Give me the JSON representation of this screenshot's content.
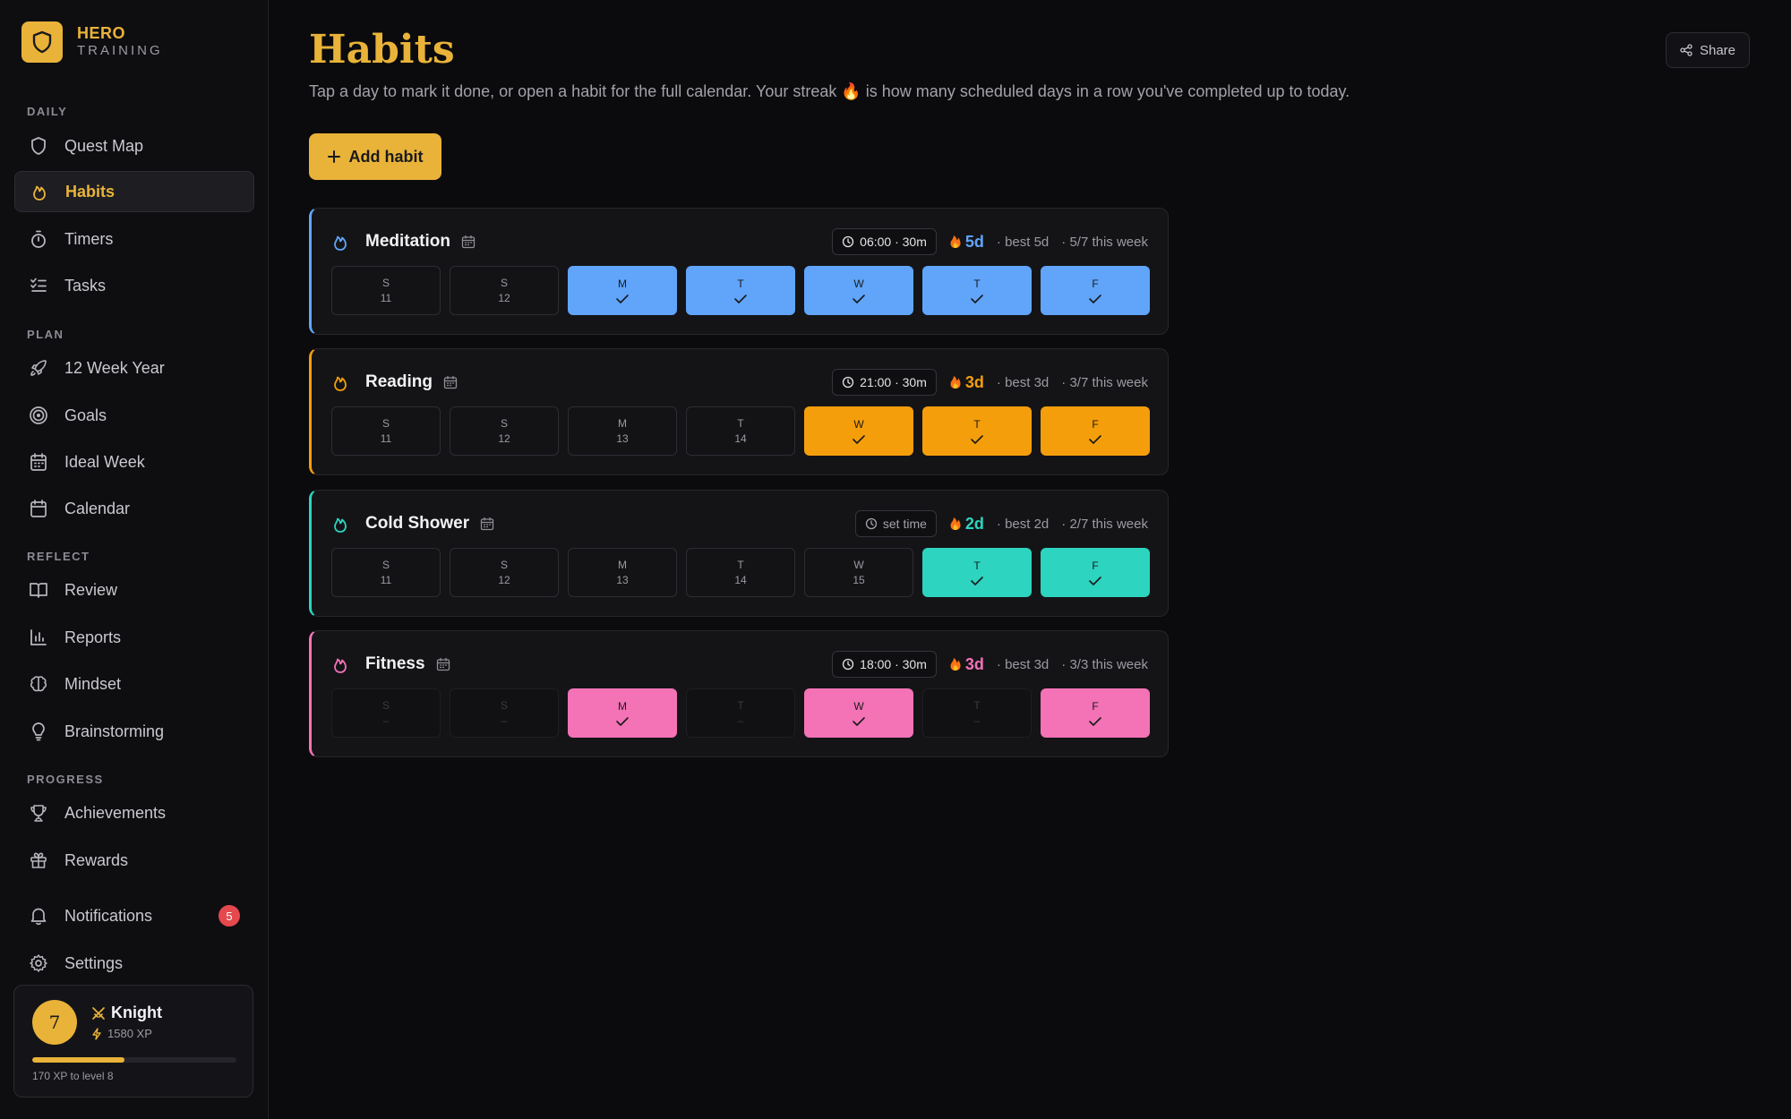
{
  "brand": {
    "title": "HERO",
    "subtitle": "TRAINING"
  },
  "sidebar": {
    "sections": {
      "daily": "DAILY",
      "plan": "PLAN",
      "reflect": "REFLECT",
      "progress": "PROGRESS"
    },
    "items": {
      "quest_map": "Quest Map",
      "habits": "Habits",
      "timers": "Timers",
      "tasks": "Tasks",
      "twelve_week": "12 Week Year",
      "goals": "Goals",
      "ideal_week": "Ideal Week",
      "calendar": "Calendar",
      "review": "Review",
      "reports": "Reports",
      "mindset": "Mindset",
      "brainstorming": "Brainstorming",
      "achievements": "Achievements",
      "rewards": "Rewards",
      "notifications": "Notifications",
      "settings": "Settings"
    },
    "notification_count": "5",
    "active": "habits"
  },
  "profile": {
    "level": "7",
    "rank": "Knight",
    "xp": "1580 XP",
    "progress_fraction": 0.45,
    "note": "170 XP to level 8"
  },
  "header": {
    "title": "Habits",
    "description": "Tap a day to mark it done, or open a habit for the full calendar. Your streak 🔥 is how many scheduled days in a row you've completed up to today.",
    "share_label": "Share",
    "add_label": "Add habit"
  },
  "colors": {
    "accent": "#e9b339",
    "meditation": "#60a5fa",
    "reading": "#f59e0b",
    "cold_shower": "#2dd4bf",
    "fitness": "#f472b6"
  },
  "habits": [
    {
      "name": "Meditation",
      "color": "#60a5fa",
      "time": "06:00 · 30m",
      "time_set": true,
      "streak": "5d",
      "best": "· best 5d",
      "week": "· 5/7 this week",
      "days": [
        {
          "letter": "S",
          "date": "11",
          "state": "open"
        },
        {
          "letter": "S",
          "date": "12",
          "state": "open"
        },
        {
          "letter": "M",
          "date": "",
          "state": "done"
        },
        {
          "letter": "T",
          "date": "",
          "state": "done"
        },
        {
          "letter": "W",
          "date": "",
          "state": "done"
        },
        {
          "letter": "T",
          "date": "",
          "state": "done"
        },
        {
          "letter": "F",
          "date": "",
          "state": "done"
        }
      ]
    },
    {
      "name": "Reading",
      "color": "#f59e0b",
      "time": "21:00 · 30m",
      "time_set": true,
      "streak": "3d",
      "best": "· best 3d",
      "week": "· 3/7 this week",
      "days": [
        {
          "letter": "S",
          "date": "11",
          "state": "open"
        },
        {
          "letter": "S",
          "date": "12",
          "state": "open"
        },
        {
          "letter": "M",
          "date": "13",
          "state": "open"
        },
        {
          "letter": "T",
          "date": "14",
          "state": "open"
        },
        {
          "letter": "W",
          "date": "",
          "state": "done"
        },
        {
          "letter": "T",
          "date": "",
          "state": "done"
        },
        {
          "letter": "F",
          "date": "",
          "state": "done"
        }
      ]
    },
    {
      "name": "Cold Shower",
      "color": "#2dd4bf",
      "time": "set time",
      "time_set": false,
      "streak": "2d",
      "best": "· best 2d",
      "week": "· 2/7 this week",
      "days": [
        {
          "letter": "S",
          "date": "11",
          "state": "open"
        },
        {
          "letter": "S",
          "date": "12",
          "state": "open"
        },
        {
          "letter": "M",
          "date": "13",
          "state": "open"
        },
        {
          "letter": "T",
          "date": "14",
          "state": "open"
        },
        {
          "letter": "W",
          "date": "15",
          "state": "open"
        },
        {
          "letter": "T",
          "date": "",
          "state": "done"
        },
        {
          "letter": "F",
          "date": "",
          "state": "done"
        }
      ]
    },
    {
      "name": "Fitness",
      "color": "#f472b6",
      "time": "18:00 · 30m",
      "time_set": true,
      "streak": "3d",
      "best": "· best 3d",
      "week": "· 3/3 this week",
      "days": [
        {
          "letter": "S",
          "date": "–",
          "state": "off"
        },
        {
          "letter": "S",
          "date": "–",
          "state": "off"
        },
        {
          "letter": "M",
          "date": "",
          "state": "done"
        },
        {
          "letter": "T",
          "date": "–",
          "state": "off"
        },
        {
          "letter": "W",
          "date": "",
          "state": "done"
        },
        {
          "letter": "T",
          "date": "–",
          "state": "off"
        },
        {
          "letter": "F",
          "date": "",
          "state": "done"
        }
      ]
    }
  ]
}
